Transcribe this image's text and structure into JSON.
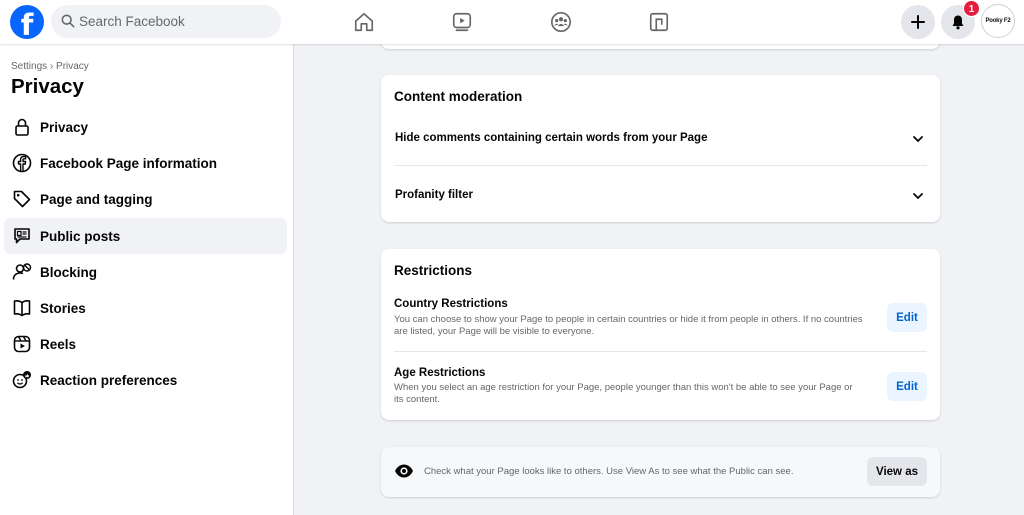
{
  "topbar": {
    "logo_letter": "f",
    "search_placeholder": "Search Facebook",
    "notification_count": "1",
    "avatar_text": "Pooky F2"
  },
  "sidebar": {
    "breadcrumb": "Settings › Privacy",
    "title": "Privacy",
    "items": [
      {
        "label": "Privacy",
        "icon": "lock-icon"
      },
      {
        "label": "Facebook Page information",
        "icon": "facebook-icon"
      },
      {
        "label": "Page and tagging",
        "icon": "tag-icon"
      },
      {
        "label": "Public posts",
        "icon": "public-posts-icon"
      },
      {
        "label": "Blocking",
        "icon": "blocking-icon"
      },
      {
        "label": "Stories",
        "icon": "stories-icon"
      },
      {
        "label": "Reels",
        "icon": "reels-icon"
      },
      {
        "label": "Reaction preferences",
        "icon": "reaction-icon"
      }
    ],
    "active_item": "Public posts"
  },
  "content_moderation": {
    "heading": "Content moderation",
    "rows": [
      {
        "label": "Hide comments containing certain words from your Page"
      },
      {
        "label": "Profanity filter"
      }
    ]
  },
  "restrictions": {
    "heading": "Restrictions",
    "items": [
      {
        "title": "Country Restrictions",
        "description": "You can choose to show your Page to people in certain countries or hide it from people in others. If no countries are listed, your Page will be visible to everyone.",
        "button": "Edit"
      },
      {
        "title": "Age Restrictions",
        "description": "When you select an age restriction for your Page, people younger than this won't be able to see your Page or its content.",
        "button": "Edit"
      }
    ]
  },
  "view_as": {
    "text": "Check what your Page looks like to others. Use View As to see what the Public can see.",
    "button": "View as"
  },
  "colors": {
    "brand": "#0866ff",
    "badge": "#e41e3f",
    "edit_button_bg": "#ebf5ff",
    "edit_button_text": "#0064d1"
  }
}
